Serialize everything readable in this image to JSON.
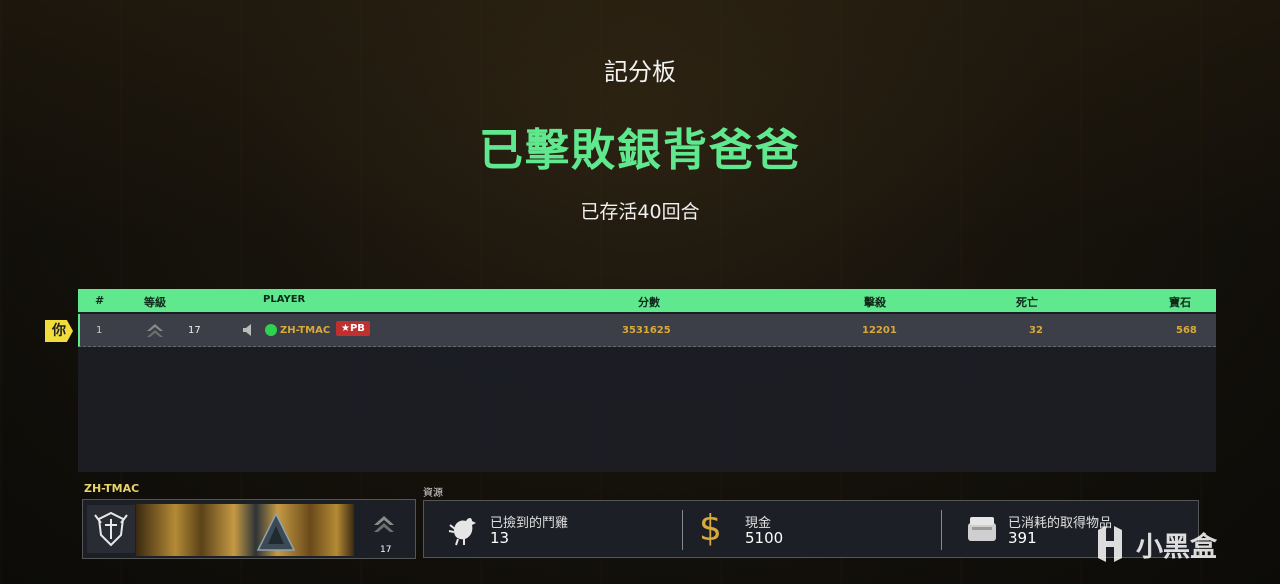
{
  "header": {
    "title": "記分板",
    "headline": "已擊敗銀背爸爸",
    "subline": "已存活40回合"
  },
  "scoreboard": {
    "columns": [
      "#",
      "等級",
      "PLAYER",
      "分數",
      "擊殺",
      "死亡",
      "寶石"
    ],
    "you_tag": "你",
    "rows": [
      {
        "rank": "1",
        "level": "17",
        "player": "ZH-TMAC",
        "badge": "★PB",
        "score": "3531625",
        "kills": "12201",
        "deaths": "32",
        "gems": "568"
      }
    ]
  },
  "player_card": {
    "name": "ZH-TMAC",
    "level": "17"
  },
  "resources": {
    "label": "資源",
    "items": [
      {
        "name": "已撿到的鬥雞",
        "value": "13",
        "icon": "rooster-icon"
      },
      {
        "name": "現金",
        "value": "5100",
        "icon": "dollar-icon"
      },
      {
        "name": "已消耗的取得物品",
        "value": "391",
        "icon": "loot-crate-icon"
      }
    ]
  },
  "watermark": {
    "text": "小黑盒"
  },
  "colors": {
    "accent_green": "#5fe88e",
    "gold": "#d9a93a",
    "you_tag": "#f0dc3c",
    "pb_badge": "#c0302f"
  }
}
